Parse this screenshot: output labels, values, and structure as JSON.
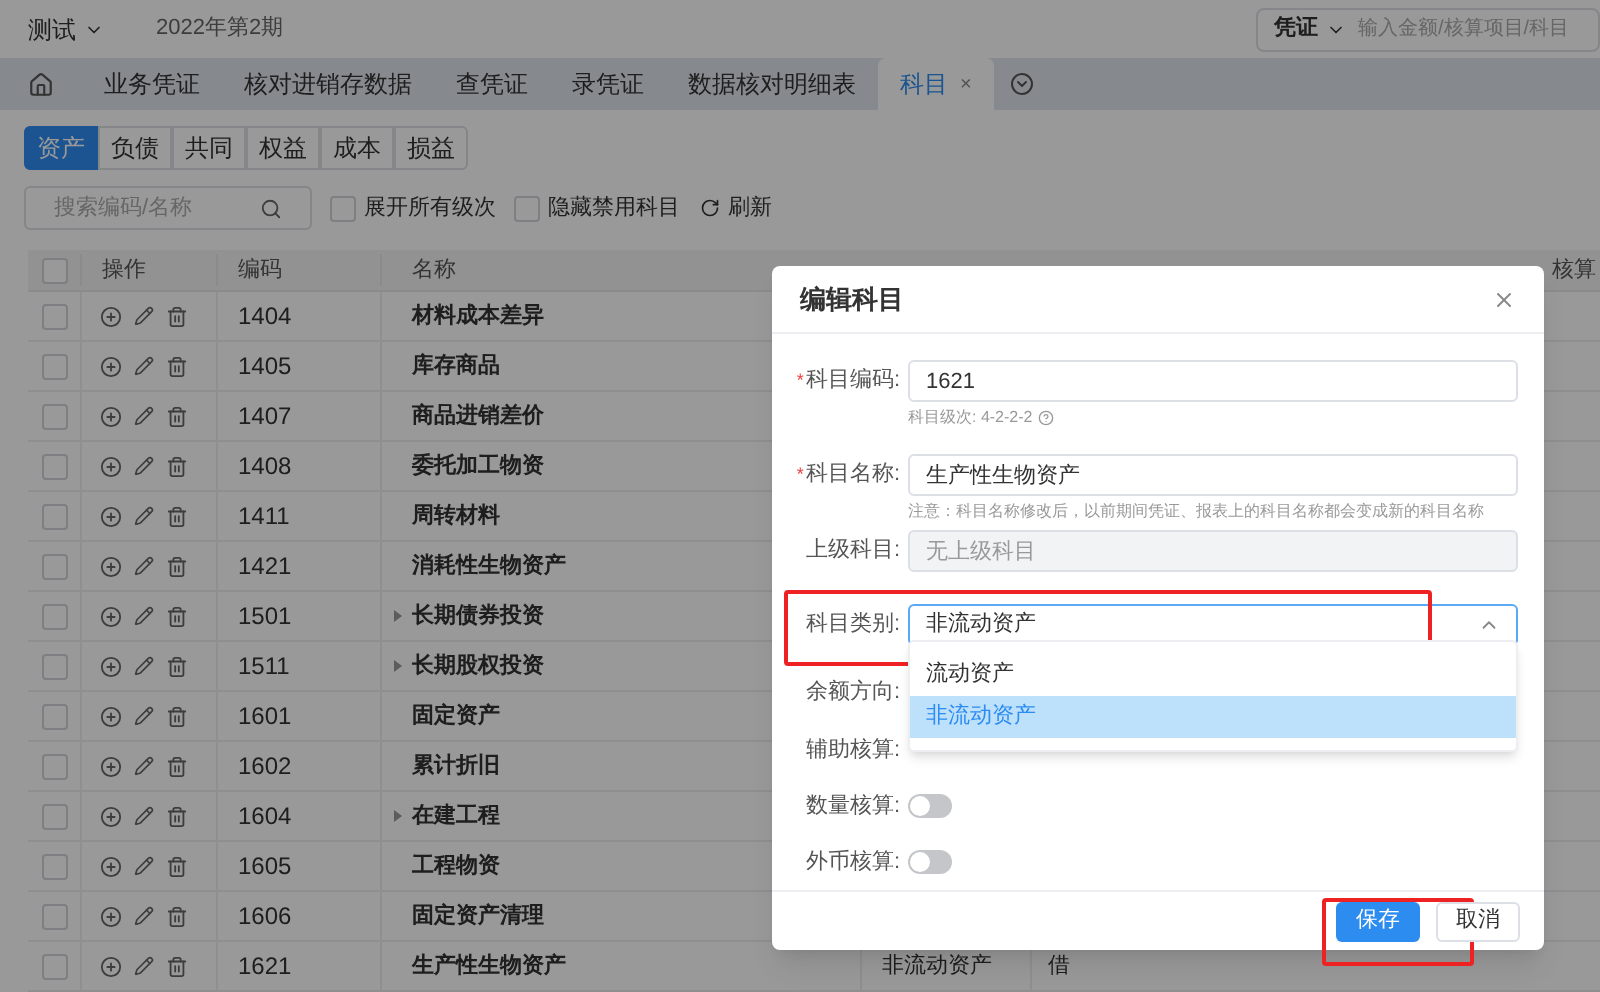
{
  "topbar": {
    "account": "测试",
    "period": "2022年第2期",
    "search_type": "凭证",
    "search_placeholder": "输入金额/核算项目/科目"
  },
  "tabs": [
    {
      "label": "业务凭证",
      "selected": false
    },
    {
      "label": "核对进销存数据",
      "selected": false
    },
    {
      "label": "查凭证",
      "selected": false
    },
    {
      "label": "录凭证",
      "selected": false
    },
    {
      "label": "数据核对明细表",
      "selected": false
    },
    {
      "label": "科目",
      "selected": true,
      "close": "×"
    }
  ],
  "categories": [
    {
      "label": "资产",
      "selected": true
    },
    {
      "label": "负债",
      "selected": false
    },
    {
      "label": "共同",
      "selected": false
    },
    {
      "label": "权益",
      "selected": false
    },
    {
      "label": "成本",
      "selected": false
    },
    {
      "label": "损益",
      "selected": false
    }
  ],
  "toolbar": {
    "search_placeholder": "搜索编码/名称",
    "options": [
      {
        "label": "展开所有级次",
        "checked": false
      },
      {
        "label": "隐藏禁用科目",
        "checked": false
      }
    ],
    "refresh": "刷新"
  },
  "table": {
    "all_checked": false,
    "columns": [
      "操作",
      "编码",
      "名称"
    ],
    "column_partial": "核算",
    "rows": [
      {
        "checked": false,
        "code": "1404",
        "name": "材料成本差异",
        "has_children": false
      },
      {
        "checked": false,
        "code": "1405",
        "name": "库存商品",
        "has_children": false
      },
      {
        "checked": false,
        "code": "1407",
        "name": "商品进销差价",
        "has_children": false
      },
      {
        "checked": false,
        "code": "1408",
        "name": "委托加工物资",
        "has_children": false
      },
      {
        "checked": false,
        "code": "1411",
        "name": "周转材料",
        "has_children": false
      },
      {
        "checked": false,
        "code": "1421",
        "name": "消耗性生物资产",
        "has_children": false
      },
      {
        "checked": false,
        "code": "1501",
        "name": "长期债券投资",
        "has_children": true
      },
      {
        "checked": false,
        "code": "1511",
        "name": "长期股权投资",
        "has_children": true
      },
      {
        "checked": false,
        "code": "1601",
        "name": "固定资产",
        "has_children": false
      },
      {
        "checked": false,
        "code": "1602",
        "name": "累计折旧",
        "has_children": false
      },
      {
        "checked": false,
        "code": "1604",
        "name": "在建工程",
        "has_children": true
      },
      {
        "checked": false,
        "code": "1605",
        "name": "工程物资",
        "has_children": false
      },
      {
        "checked": false,
        "code": "1606",
        "name": "固定资产清理",
        "has_children": false
      },
      {
        "checked": false,
        "code": "1621",
        "name": "生产性生物资产",
        "has_children": false,
        "category": "非流动资产",
        "direction": "借"
      }
    ]
  },
  "dialog": {
    "title": "编辑科目",
    "required_mark": "*",
    "fields": [
      {
        "kind": "text",
        "label": "科目编码:",
        "required": true,
        "value": "1621",
        "hint": "科目级次: 4-2-2-2"
      },
      {
        "kind": "text",
        "label": "科目名称:",
        "required": true,
        "value": "生产性生物资产",
        "hint": "注意：科目名称修改后，以前期间凭证、报表上的科目名称都会变成新的科目名称"
      },
      {
        "kind": "disabled",
        "label": "上级科目:",
        "required": false,
        "placeholder": "无上级科目"
      },
      {
        "kind": "select",
        "label": "科目类别:",
        "required": false,
        "value": "非流动资产",
        "highlighted": true
      },
      {
        "kind": "covered",
        "label": "余额方向:",
        "required": false
      },
      {
        "kind": "covered",
        "label": "辅助核算:",
        "required": false
      },
      {
        "kind": "toggle",
        "label": "数量核算:",
        "required": false,
        "on": false
      },
      {
        "kind": "toggle",
        "label": "外币核算:",
        "required": false,
        "on": false
      }
    ],
    "dropdown": [
      {
        "label": "流动资产",
        "selected": false
      },
      {
        "label": "非流动资产",
        "selected": true
      }
    ],
    "buttons": [
      {
        "label": "保存",
        "kind": "primary",
        "highlighted": true
      },
      {
        "label": "取消",
        "kind": "default",
        "highlighted": false
      }
    ]
  }
}
